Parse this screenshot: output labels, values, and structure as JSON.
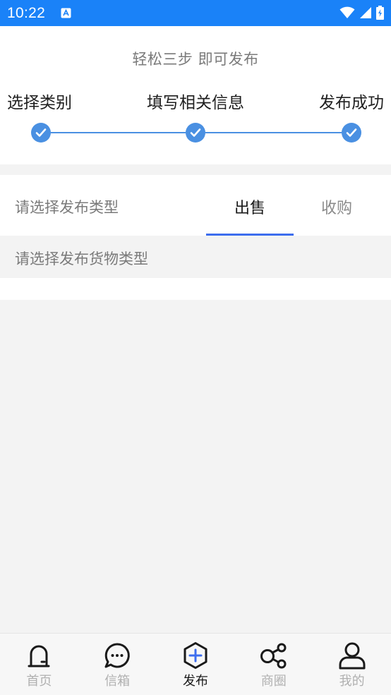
{
  "status_bar": {
    "time": "10:22"
  },
  "steps": {
    "subtitle": "轻松三步  即可发布",
    "items": [
      {
        "label": "选择类别"
      },
      {
        "label": "填写相关信息"
      },
      {
        "label": "发布成功"
      }
    ]
  },
  "publish_type": {
    "prompt": "请选择发布类型",
    "tabs": [
      {
        "label": "出售",
        "active": true
      },
      {
        "label": "收购",
        "active": false
      }
    ]
  },
  "goods_type": {
    "prompt": "请选择发布货物类型"
  },
  "bottom_nav": {
    "items": [
      {
        "label": "首页",
        "icon": "home-icon",
        "active": false
      },
      {
        "label": "信箱",
        "icon": "chat-bubble-icon",
        "active": false
      },
      {
        "label": "发布",
        "icon": "publish-plus-icon",
        "active": true
      },
      {
        "label": "商圈",
        "icon": "share-network-icon",
        "active": false
      },
      {
        "label": "我的",
        "icon": "profile-icon",
        "active": false
      }
    ]
  },
  "colors": {
    "status_bar": "#1a82f8",
    "step_accent": "#4a90e2",
    "tab_indicator": "#3d6dee",
    "nav_active_icon": "#3d6dee"
  }
}
